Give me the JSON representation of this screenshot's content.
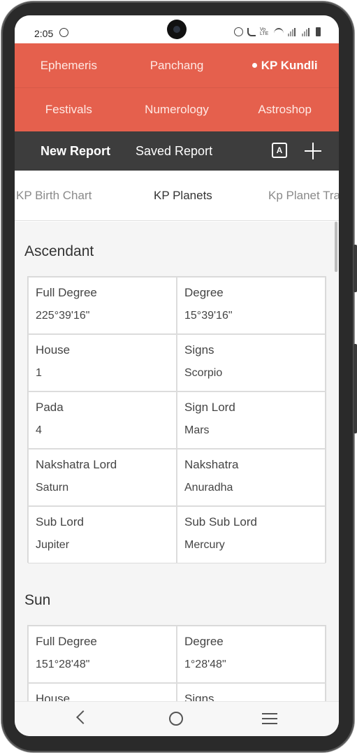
{
  "status": {
    "time": "2:05"
  },
  "topnav": {
    "row1": [
      "Ephemeris",
      "Panchang",
      "KP Kundli"
    ],
    "row2": [
      "Festivals",
      "Numerology",
      "Astroshop"
    ],
    "active": "KP Kundli"
  },
  "report": {
    "new": "New Report",
    "saved": "Saved Report",
    "translate_glyph": "A"
  },
  "subtabs": [
    "KP Birth Chart",
    "KP Planets",
    "Kp Planet Tra"
  ],
  "sections": [
    {
      "title": "Ascendant",
      "cells": [
        {
          "label": "Full Degree",
          "value": "225°39'16\""
        },
        {
          "label": "Degree",
          "value": "15°39'16\""
        },
        {
          "label": "House",
          "value": "1"
        },
        {
          "label": "Signs",
          "value": "Scorpio"
        },
        {
          "label": "Pada",
          "value": "4"
        },
        {
          "label": "Sign Lord",
          "value": "Mars"
        },
        {
          "label": "Nakshatra Lord",
          "value": "Saturn"
        },
        {
          "label": "Nakshatra",
          "value": "Anuradha"
        },
        {
          "label": "Sub Lord",
          "value": "Jupiter"
        },
        {
          "label": "Sub Sub Lord",
          "value": "Mercury"
        }
      ]
    },
    {
      "title": "Sun",
      "cells": [
        {
          "label": "Full Degree",
          "value": "151°28'48\""
        },
        {
          "label": "Degree",
          "value": "1°28'48\""
        },
        {
          "label": "House",
          "value": ""
        },
        {
          "label": "Signs",
          "value": ""
        }
      ]
    }
  ],
  "colors": {
    "accent": "#e5604d",
    "bar": "#3d3d3d"
  }
}
